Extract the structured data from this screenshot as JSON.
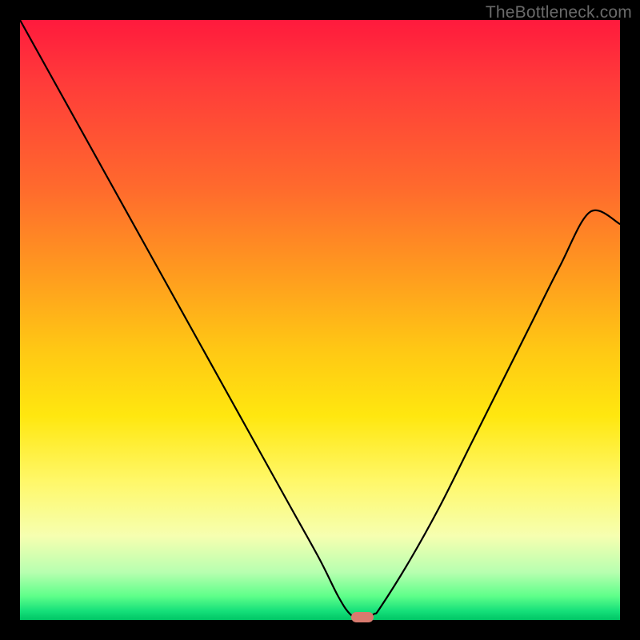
{
  "watermark": "TheBottleneck.com",
  "colors": {
    "frame": "#000000",
    "gradient_top": "#ff1a3d",
    "gradient_bottom": "#00c565",
    "curve": "#000000",
    "marker": "#d87a6e"
  },
  "chart_data": {
    "type": "line",
    "title": "",
    "xlabel": "",
    "ylabel": "",
    "xlim": [
      0,
      100
    ],
    "ylim": [
      0,
      100
    ],
    "grid": false,
    "series": [
      {
        "name": "bottleneck-curve",
        "x": [
          0,
          5,
          10,
          15,
          20,
          25,
          30,
          35,
          40,
          45,
          50,
          53,
          55,
          57,
          59,
          60,
          65,
          70,
          75,
          80,
          85,
          90,
          95,
          100
        ],
        "values": [
          100,
          91,
          82,
          73,
          64,
          55,
          46,
          37,
          28,
          19,
          10,
          4,
          1,
          0,
          1,
          2,
          10,
          19,
          29,
          39,
          49,
          59,
          68,
          66
        ]
      }
    ],
    "annotations": [
      {
        "name": "optimal-marker",
        "x": 57,
        "y": 0.5
      }
    ],
    "note": "Axis values are normalized 0-100; no tick labels or axis titles are rendered in the source image."
  }
}
